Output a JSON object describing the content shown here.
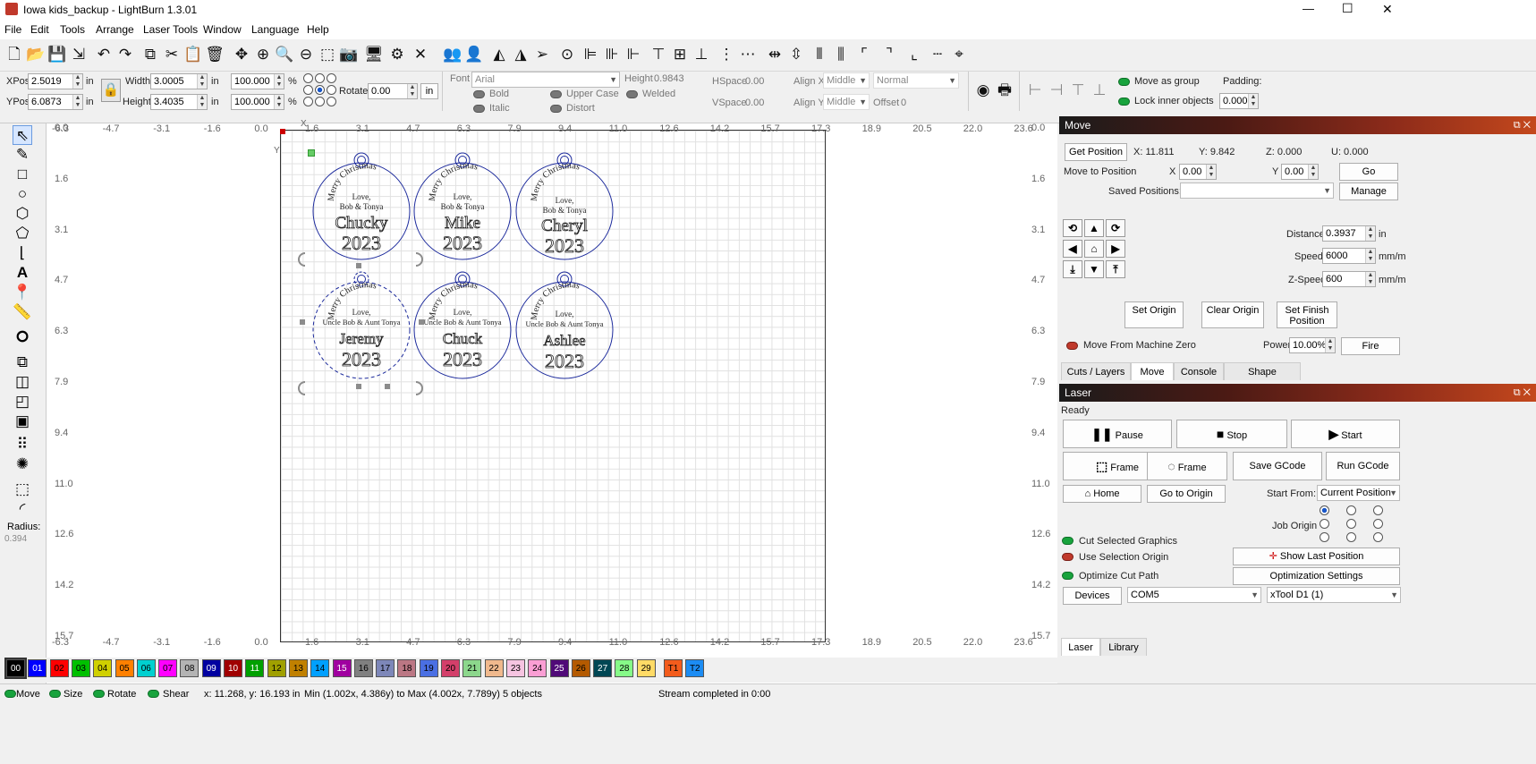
{
  "window": {
    "title": "Iowa kids_backup - LightBurn 1.3.01",
    "controls": [
      "—",
      "☐",
      "✕"
    ]
  },
  "menu": [
    "File",
    "Edit",
    "Tools",
    "Arrange",
    "Laser Tools",
    "Window",
    "Language",
    "Help"
  ],
  "props": {
    "xpos_label": "XPos",
    "xpos": "2.5019",
    "ypos_label": "YPos",
    "ypos": "6.0873",
    "unit": "in",
    "width_label": "Width",
    "width": "3.0005",
    "height_label": "Height",
    "height": "3.4035",
    "wpct": "100.000",
    "hpct": "100.000",
    "pct": "%",
    "rotate_label": "Rotate",
    "rotate": "0.00",
    "in_btn": "in",
    "font_label": "Font",
    "font": "Arial",
    "fheight_label": "Height",
    "fheight": "0.9843",
    "hspace_label": "HSpace",
    "hspace": "0.00",
    "vspace_label": "VSpace",
    "vspace": "0.00",
    "alignx_label": "Align X",
    "alignx": "Middle",
    "aligny_label": "Align Y",
    "aligny": "Middle",
    "mode": "Normal",
    "offset_label": "Offset",
    "offset": "0",
    "bold": "Bold",
    "italic": "Italic",
    "upper": "Upper Case",
    "distort": "Distort",
    "welded": "Welded",
    "move_group": "Move as group",
    "lock_inner": "Lock inner objects",
    "padding_label": "Padding:",
    "padding": "0.000"
  },
  "ruler": {
    "x_labels": [
      "-6.3",
      "-4.7",
      "-3.1",
      "-1.6",
      "0.0",
      "1.6",
      "3.1",
      "4.7",
      "6.3",
      "7.9",
      "9.4",
      "11.0",
      "12.6",
      "14.2",
      "15.7",
      "17.3",
      "18.9",
      "20.5",
      "22.0",
      "23.6"
    ],
    "y_labels": [
      "0.0",
      "1.6",
      "3.1",
      "4.7",
      "6.3",
      "7.9",
      "9.4",
      "11.0",
      "12.6",
      "14.2",
      "15.7"
    ],
    "x_mark": "X",
    "y_mark": "Y"
  },
  "ornaments": [
    {
      "greeting": "Merry Christmas",
      "love": "Love,",
      "from": "Bob & Tonya",
      "name": "Chucky",
      "year": "2023"
    },
    {
      "greeting": "Merry Christmas",
      "love": "Love,",
      "from": "Bob & Tonya",
      "name": "Mike",
      "year": "2023"
    },
    {
      "greeting": "Merry Christmas",
      "love": "Love,",
      "from": "Bob & Tonya",
      "name": "Cheryl",
      "year": "2023"
    },
    {
      "greeting": "Merry Christmas",
      "love": "Love,",
      "from": "Uncle Bob & Aunt Tonya",
      "name": "Jeremy",
      "year": "2023"
    },
    {
      "greeting": "Merry Christmas",
      "love": "Love,",
      "from": "Uncle Bob & Aunt Tonya",
      "name": "Chuck",
      "year": "2023"
    },
    {
      "greeting": "Merry Christmas",
      "love": "Love,",
      "from": "Uncle Bob & Aunt Tonya",
      "name": "Ashlee",
      "year": "2023"
    }
  ],
  "left_tools": {
    "radius_label": "Radius:",
    "radius": "0.394"
  },
  "move_panel": {
    "title": "Move",
    "get_position": "Get Position",
    "x_pos": "X: 11.811",
    "y_pos": "Y: 9.842",
    "z_pos": "Z: 0.000",
    "u_pos": "U: 0.000",
    "move_to": "Move to Position",
    "x_label": "X",
    "x_val": "0.00",
    "y_label": "Y",
    "y_val": "0.00",
    "go": "Go",
    "saved_label": "Saved Positions:",
    "manage": "Manage",
    "distance_label": "Distance",
    "distance": "0.3937",
    "distance_unit": "in",
    "speed_label": "Speed",
    "speed": "6000",
    "speed_unit": "mm/m",
    "zspeed_label": "Z-Speed",
    "zspeed": "600",
    "zspeed_unit": "mm/m",
    "set_origin": "Set Origin",
    "clear_origin": "Clear Origin",
    "set_finish": "Set Finish Position",
    "from_machine_zero": "Move From Machine Zero",
    "power_label": "Power",
    "power": "10.00%",
    "fire": "Fire",
    "tabs": [
      "Cuts / Layers",
      "Move",
      "Console",
      "Shape Properties"
    ]
  },
  "laser_panel": {
    "title": "Laser",
    "status": "Ready",
    "pause": "Pause",
    "stop": "Stop",
    "start": "Start",
    "frame1": "Frame",
    "frame2": "Frame",
    "save_gcode": "Save GCode",
    "run_gcode": "Run GCode",
    "home": "Home",
    "go_to_origin": "Go to Origin",
    "start_from_label": "Start From:",
    "start_from": "Current Position",
    "job_origin": "Job Origin",
    "cut_selected": "Cut Selected Graphics",
    "use_sel_origin": "Use Selection Origin",
    "optimize": "Optimize Cut Path",
    "show_last": "Show Last Position",
    "opt_settings": "Optimization Settings",
    "devices": "Devices",
    "port": "COM5",
    "device": "xTool D1 (1)",
    "tabs": [
      "Laser",
      "Library"
    ]
  },
  "palette": [
    {
      "l": "00",
      "c": "#000000"
    },
    {
      "l": "01",
      "c": "#0000ff"
    },
    {
      "l": "02",
      "c": "#ff0000"
    },
    {
      "l": "03",
      "c": "#00c000"
    },
    {
      "l": "04",
      "c": "#d0d000"
    },
    {
      "l": "05",
      "c": "#ff8000"
    },
    {
      "l": "06",
      "c": "#00d0d0"
    },
    {
      "l": "07",
      "c": "#ff00ff"
    },
    {
      "l": "08",
      "c": "#b4b4b4"
    },
    {
      "l": "09",
      "c": "#0000a0"
    },
    {
      "l": "10",
      "c": "#a00000"
    },
    {
      "l": "11",
      "c": "#00a000"
    },
    {
      "l": "12",
      "c": "#a0a000"
    },
    {
      "l": "13",
      "c": "#c08000"
    },
    {
      "l": "14",
      "c": "#00a0ff"
    },
    {
      "l": "15",
      "c": "#a000a0"
    },
    {
      "l": "16",
      "c": "#808080"
    },
    {
      "l": "17",
      "c": "#7d87b9"
    },
    {
      "l": "18",
      "c": "#bb7784"
    },
    {
      "l": "19",
      "c": "#4a6fe3"
    },
    {
      "l": "20",
      "c": "#d33f6a"
    },
    {
      "l": "21",
      "c": "#8cd78c"
    },
    {
      "l": "22",
      "c": "#f0b98d"
    },
    {
      "l": "23",
      "c": "#f6c4e1"
    },
    {
      "l": "24",
      "c": "#fa9ed4"
    },
    {
      "l": "25",
      "c": "#500a78"
    },
    {
      "l": "26",
      "c": "#b45a00"
    },
    {
      "l": "27",
      "c": "#004754"
    },
    {
      "l": "28",
      "c": "#86fa88"
    },
    {
      "l": "29",
      "c": "#ffdb66"
    },
    {
      "l": "T1",
      "c": "#f35c1c"
    },
    {
      "l": "T2",
      "c": "#1c8cf3"
    }
  ],
  "status": {
    "move": "Move",
    "size": "Size",
    "rotate": "Rotate",
    "shear": "Shear",
    "coords": "x: 11.268, y: 16.193 in",
    "bounds": "Min (1.002x, 4.386y) to Max (4.002x, 7.789y)  5 objects",
    "stream": "Stream completed in 0:00"
  }
}
